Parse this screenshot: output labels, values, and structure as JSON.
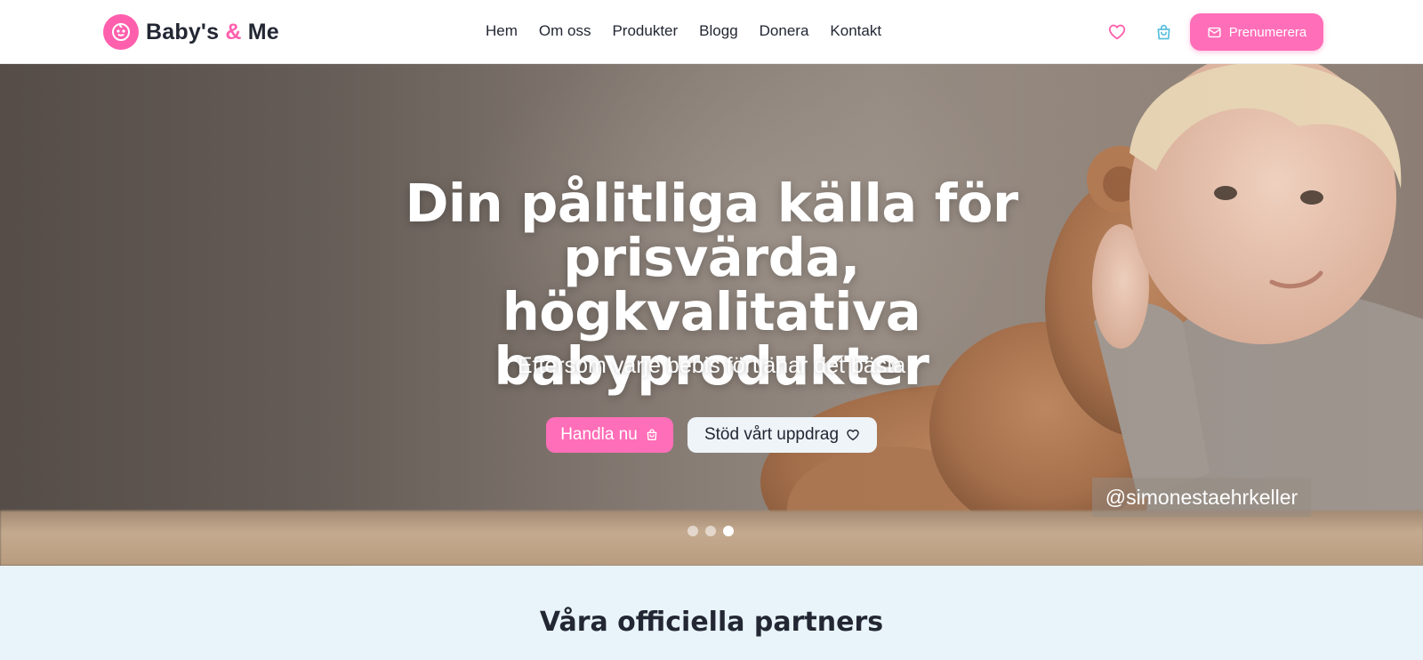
{
  "brand": {
    "name_part1": "Baby's ",
    "name_amp": "&",
    "name_part2": " Me",
    "logo_icon": "baby-face-icon",
    "accent_color": "#ff5fad"
  },
  "nav": {
    "items": [
      {
        "label": "Hem"
      },
      {
        "label": "Om oss"
      },
      {
        "label": "Produkter"
      },
      {
        "label": "Blogg"
      },
      {
        "label": "Donera"
      },
      {
        "label": "Kontakt"
      }
    ]
  },
  "header_actions": {
    "favorites_icon": "heart-icon",
    "cart_icon": "shopping-bag-icon",
    "subscribe_label": "Prenumerera",
    "subscribe_icon": "mail-icon"
  },
  "hero": {
    "title_lines": [
      "Din pålitliga källa för",
      "prisvärda, högkvalitativa",
      "babyprodukter"
    ],
    "subtitle": "Eftersom varje bebis förtjänar det bästa",
    "primary_button": {
      "label": "Handla nu",
      "icon": "shopping-bag-icon"
    },
    "secondary_button": {
      "label": "Stöd vårt uppdrag",
      "icon": "heart-icon"
    },
    "photo_credit": "@simonestaehrkeller",
    "slides_total": 3,
    "active_slide": 3
  },
  "partners": {
    "title": "Våra officiella partners"
  },
  "colors": {
    "pink": "#ff6eb8",
    "text_dark": "#232733",
    "section_bg": "#e8f4fa",
    "cart_icon": "#5bc0de"
  }
}
